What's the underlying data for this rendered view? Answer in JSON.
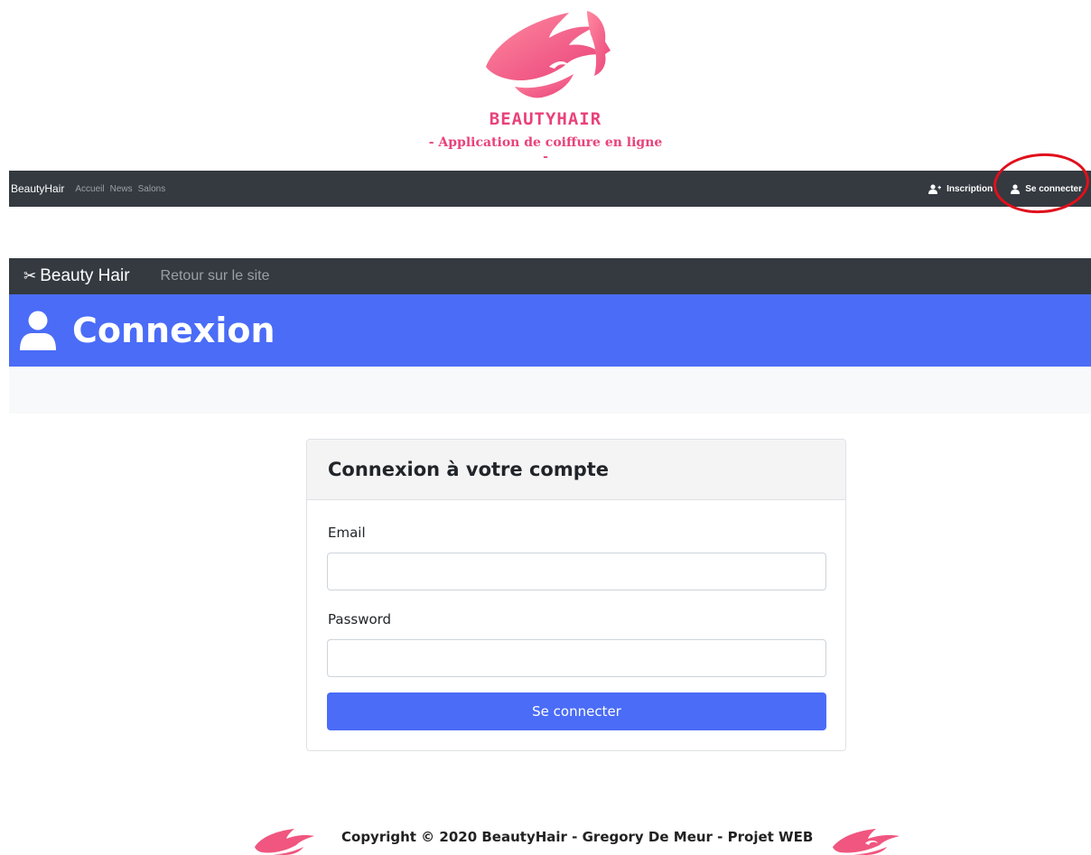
{
  "logo": {
    "title": "BEAUTYHAIR",
    "subtitle": "- Application de coiffure en ligne -",
    "icon": "woman-hair-logo-icon",
    "color": "#e9427a"
  },
  "top_nav": {
    "brand": "BeautyHair",
    "links": [
      "Accueil",
      "News",
      "Salons"
    ],
    "register_label": "Inscription",
    "register_icon": "user-plus-icon",
    "login_label": "Se connecter",
    "login_icon": "user-icon",
    "background": "#343a40"
  },
  "admin_nav": {
    "brand": "Beauty Hair",
    "brand_icon": "scissors-icon",
    "back_link": "Retour sur le site"
  },
  "hero": {
    "title": "Connexion",
    "icon": "user-icon",
    "background": "#4a6cf7"
  },
  "login_card": {
    "title": "Connexion à votre compte",
    "email_label": "Email",
    "email_value": "",
    "password_label": "Password",
    "password_value": "",
    "submit_label": "Se connecter",
    "submit_color": "#4a6cf7"
  },
  "footer": {
    "text": "Copyright © 2020 BeautyHair - Gregory De Meur - Projet WEB",
    "logo_icon": "woman-hair-logo-icon"
  }
}
